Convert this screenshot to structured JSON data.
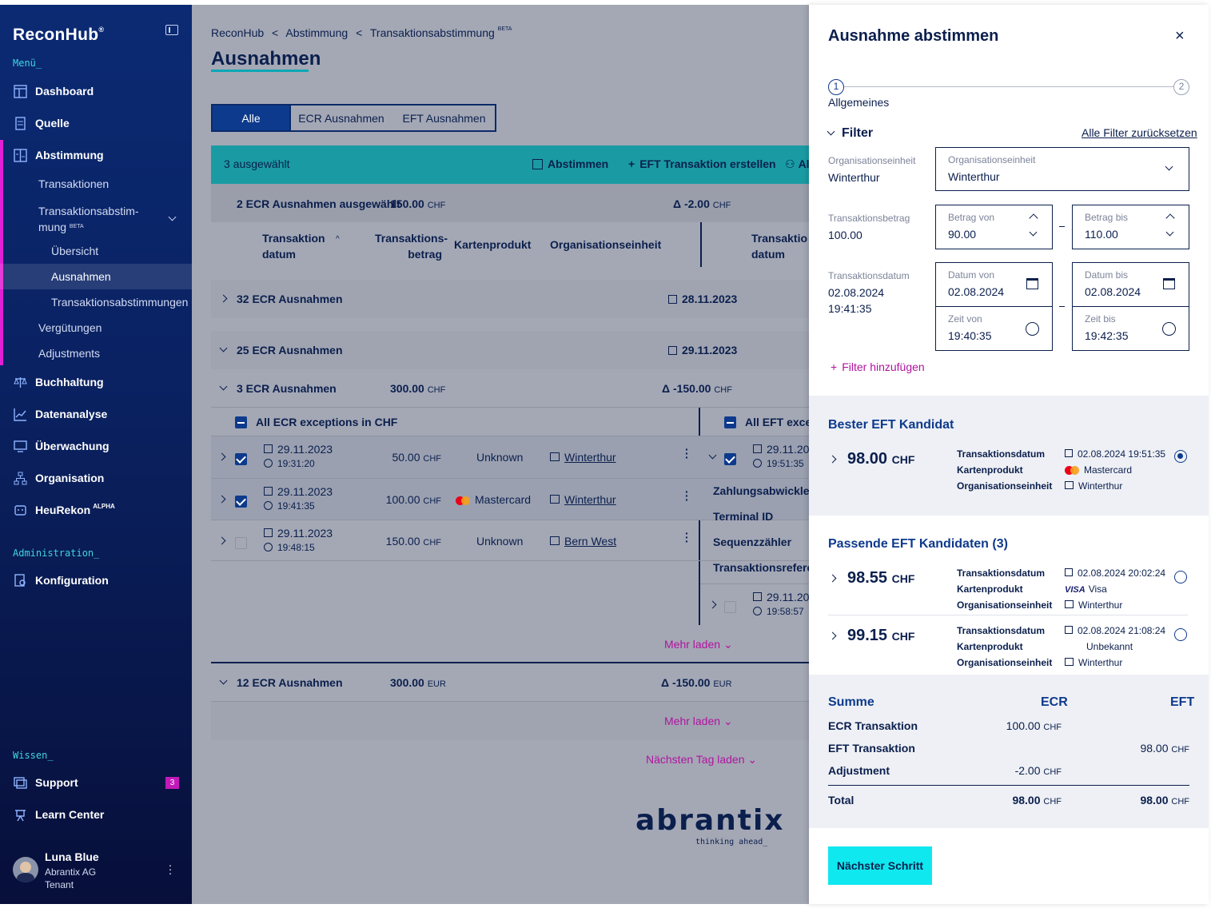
{
  "app": {
    "logo": "ReconHub",
    "logo_mark": "®"
  },
  "sidebar": {
    "menu_title": "Menü_",
    "items": [
      {
        "label": "Dashboard",
        "icon": "dashboard-icon"
      },
      {
        "label": "Quelle",
        "icon": "source-icon"
      },
      {
        "label": "Abstimmung",
        "icon": "reconcile-icon"
      }
    ],
    "abstimmung_sub": [
      "Transaktionen",
      "Transaktionsabstim-",
      "mung",
      "BETA"
    ],
    "sub_level": [
      "Übersicht",
      "Ausnahmen",
      "Transaktionsabstimmungen"
    ],
    "sub2": [
      "Vergütungen",
      "Adjustments"
    ],
    "items2": [
      {
        "label": "Buchhaltung",
        "icon": "scale-icon"
      },
      {
        "label": "Datenanalyse",
        "icon": "chart-line-icon"
      },
      {
        "label": "Überwachung",
        "icon": "monitor-icon"
      },
      {
        "label": "Organisation",
        "icon": "org-icon"
      },
      {
        "label": "HeuRekon",
        "sup": "ALPHA",
        "icon": "robot-icon"
      }
    ],
    "admin_title": "Administration_",
    "admin_item": "Konfiguration",
    "wissen_title": "Wissen_",
    "support": "Support",
    "support_badge": "3",
    "learn": "Learn Center",
    "user": {
      "name": "Luna Blue",
      "company": "Abrantix AG",
      "role": "Tenant"
    }
  },
  "main": {
    "breadcrumb": [
      "ReconHub",
      "Abstimmung",
      "Transaktionsabstimmung",
      "BETA"
    ],
    "title": "Ausnahmen",
    "tabs": [
      "Alle",
      "ECR Ausnahmen",
      "EFT Ausnahmen"
    ],
    "action": {
      "selected": "3 ausgewählt",
      "reconcile": "Abstimmen",
      "create": "EFT Transaktion erstellen",
      "more": "Al"
    },
    "summary": {
      "label": "2 ECR Ausnahmen ausgewählt",
      "amount": "150.00",
      "currency": "CHF",
      "delta": "Δ -2.00",
      "delta_cur": "CHF"
    },
    "columns": {
      "date": [
        "Transaktion",
        "datum"
      ],
      "amount": [
        "Transaktions-",
        "betrag"
      ],
      "card": "Kartenprodukt",
      "org": "Organisationseinheit",
      "date2": [
        "Transaktio",
        "datum"
      ]
    },
    "groups": [
      {
        "label": "32 ECR Ausnahmen",
        "date": "28.11.2023"
      },
      {
        "label": "25 ECR Ausnahmen",
        "date": "29.11.2023"
      }
    ],
    "group3": {
      "label": "3 ECR Ausnahmen",
      "amount": "300.00",
      "currency": "CHF",
      "delta": "Δ -150.00",
      "delta_cur": "CHF"
    },
    "all_ecr": "All ECR exceptions in CHF",
    "all_eft": "All EFT except",
    "rows": [
      {
        "date": "29.11.2023",
        "time": "19:31:20",
        "amount": "50.00",
        "cur": "CHF",
        "card": "Unknown",
        "org": "Winterthur"
      },
      {
        "date": "29.11.2023",
        "time": "19:41:35",
        "amount": "100.00",
        "cur": "CHF",
        "card": "Mastercard",
        "org": "Winterthur"
      },
      {
        "date": "29.11.2023",
        "time": "19:48:15",
        "amount": "150.00",
        "cur": "CHF",
        "card": "Unknown",
        "org": "Bern West"
      }
    ],
    "eft_rows": [
      {
        "date": "29.11.202",
        "time": "19:51:35"
      },
      {
        "date": "29.11.202",
        "time": "19:58:57"
      }
    ],
    "eft_details": [
      "Zahlungsabwickler",
      "Terminal ID",
      "Sequenzzähler",
      "Transaktionsreferen"
    ],
    "mehr_laden": "Mehr laden",
    "group4": {
      "label": "12 ECR Ausnahmen",
      "amount": "300.00",
      "currency": "EUR",
      "delta": "Δ -150.00",
      "delta_cur": "EUR"
    },
    "next_day": "Nächsten Tag laden",
    "brand": "abrantix",
    "brand_tag": "thinking ahead_"
  },
  "panel": {
    "title": "Ausnahme abstimmen",
    "step1": "1",
    "step2": "2",
    "step_label": "Allgemeines",
    "filter": "Filter",
    "reset": "Alle Filter zurücksetzen",
    "org": {
      "label": "Organisationseinheit",
      "value": "Winterthur"
    },
    "amount": {
      "label": "Transaktionsbetrag",
      "value": "100.00",
      "from_label": "Betrag von",
      "from": "90.00",
      "to_label": "Betrag bis",
      "to": "110.00"
    },
    "date": {
      "label": "Transaktionsdatum",
      "value": "02.08.2024",
      "time": "19:41:35",
      "from_label": "Datum von",
      "from": "02.08.2024",
      "to_label": "Datum bis",
      "to": "02.08.2024",
      "tfrom_label": "Zeit von",
      "tfrom": "19:40:35",
      "tto_label": "Zeit bis",
      "tto": "19:42:35"
    },
    "add_filter": "Filter hinzufügen",
    "best_title": "Bester EFT Kandidat",
    "keys": [
      "Transaktionsdatum",
      "Kartenprodukt",
      "Organisationseinheit"
    ],
    "best": {
      "amount": "98.00",
      "cur": "CHF",
      "date": "02.08.2024 19:51:35",
      "card": "Mastercard",
      "org": "Winterthur"
    },
    "match_title": "Passende EFT Kandidaten (3)",
    "matches": [
      {
        "amount": "98.55",
        "cur": "CHF",
        "date": "02.08.2024 20:02:24",
        "card_brand": "VISA",
        "card": "Visa",
        "org": "Winterthur"
      },
      {
        "amount": "99.15",
        "cur": "CHF",
        "date": "02.08.2024 21:08:24",
        "card": "Unbekannt",
        "org": "Winterthur"
      }
    ],
    "sum": {
      "title": "Summe",
      "ecr": "ECR",
      "eft": "EFT",
      "rows": [
        {
          "label": "ECR Transaktion",
          "ecr": "100.00",
          "ecr_cur": "CHF"
        },
        {
          "label": "EFT Transaktion",
          "eft": "98.00",
          "eft_cur": "CHF"
        },
        {
          "label": "Adjustment",
          "ecr": "-2.00",
          "ecr_cur": "CHF"
        }
      ],
      "total": {
        "label": "Total",
        "ecr": "98.00",
        "eft": "98.00",
        "cur": "CHF"
      }
    },
    "next": "Nächster Schritt"
  }
}
